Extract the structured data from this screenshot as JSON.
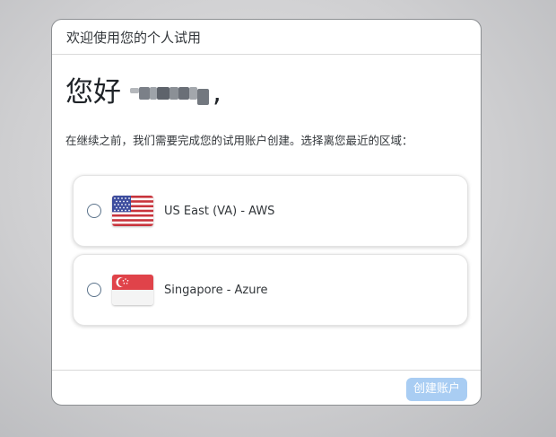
{
  "dialog": {
    "title": "欢迎使用您的个人试用"
  },
  "greeting": {
    "prefix": "您好",
    "suffix": ","
  },
  "instruction": "在继续之前，我们需要完成您的试用账户创建。选择离您最近的区域：",
  "regions": [
    {
      "label": "US East (VA) - AWS",
      "flag": "us-flag-icon",
      "selected": false
    },
    {
      "label": "Singapore - Azure",
      "flag": "singapore-flag-icon",
      "selected": false
    }
  ],
  "footer": {
    "create_button_label": "创建账户",
    "create_button_enabled": false
  },
  "colors": {
    "primary_button_disabled": "#a9cdf3",
    "radio_border": "#5b738b"
  }
}
